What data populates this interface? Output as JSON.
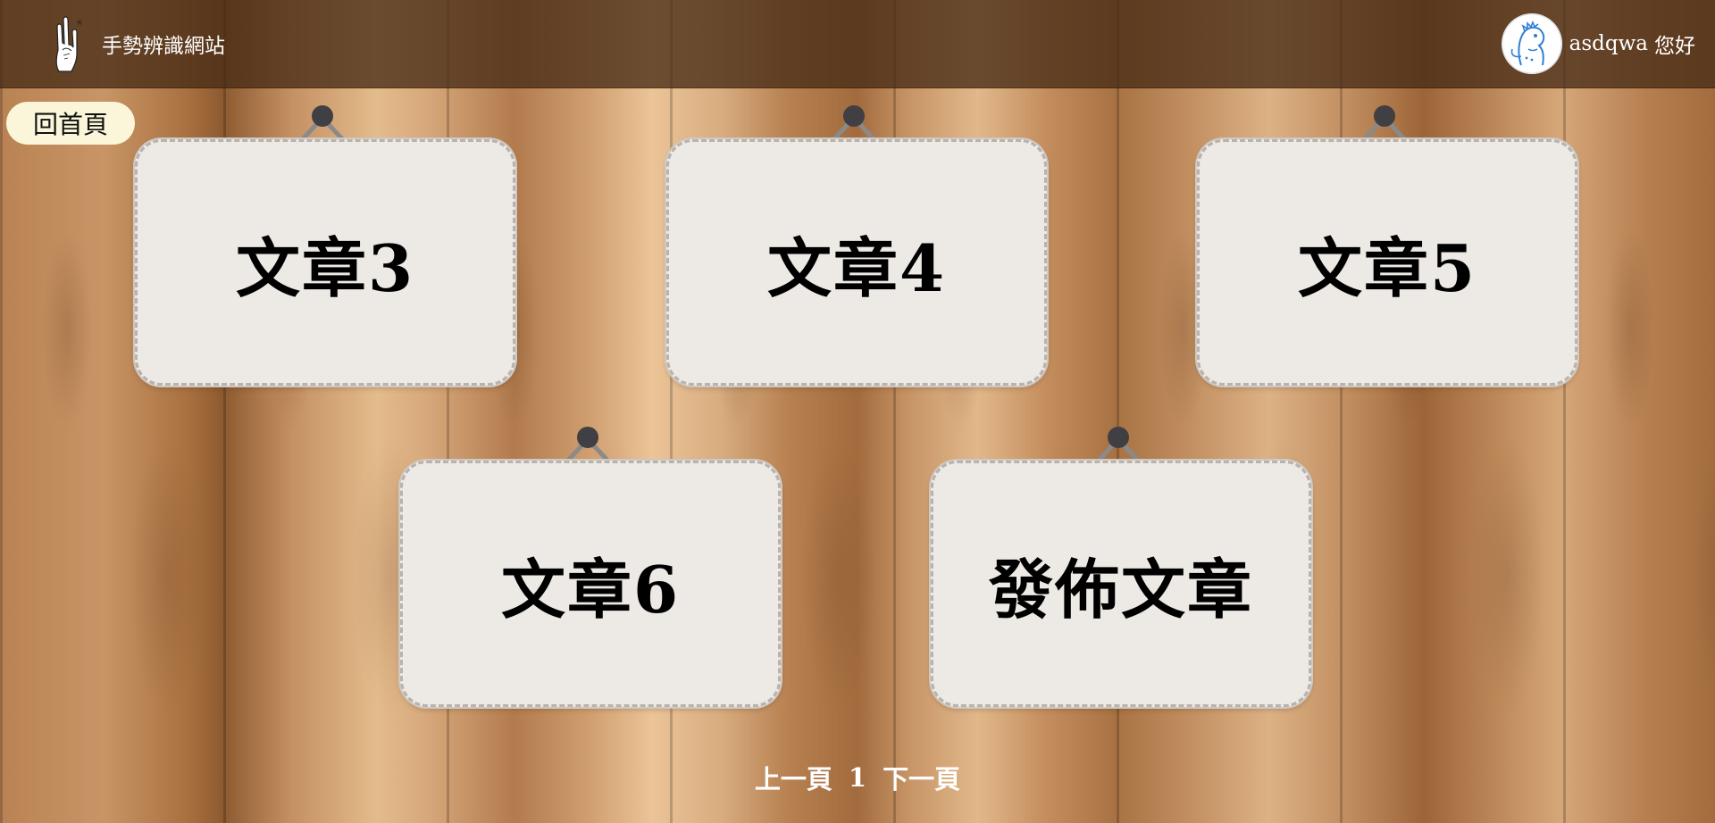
{
  "header": {
    "logo_icon": "rock-hand-gesture-icon",
    "site_title": "手勢辨識網站",
    "avatar_icon": "dinosaur-avatar-icon",
    "username": "asdqwa",
    "greeting": "您好"
  },
  "nav": {
    "home_label": "回首頁"
  },
  "cards": [
    {
      "label": "文章3"
    },
    {
      "label": "文章4"
    },
    {
      "label": "文章5"
    },
    {
      "label": "文章6"
    },
    {
      "label": "發佈文章"
    }
  ],
  "pagination": {
    "prev_label": "上一頁",
    "current_page": "1",
    "next_label": "下一頁"
  },
  "colors": {
    "header_bg": "#4a2e18",
    "card_bg": "#ede9e4",
    "home_button_bg": "#fbf6d9",
    "avatar_accent": "#2f7fd6"
  }
}
